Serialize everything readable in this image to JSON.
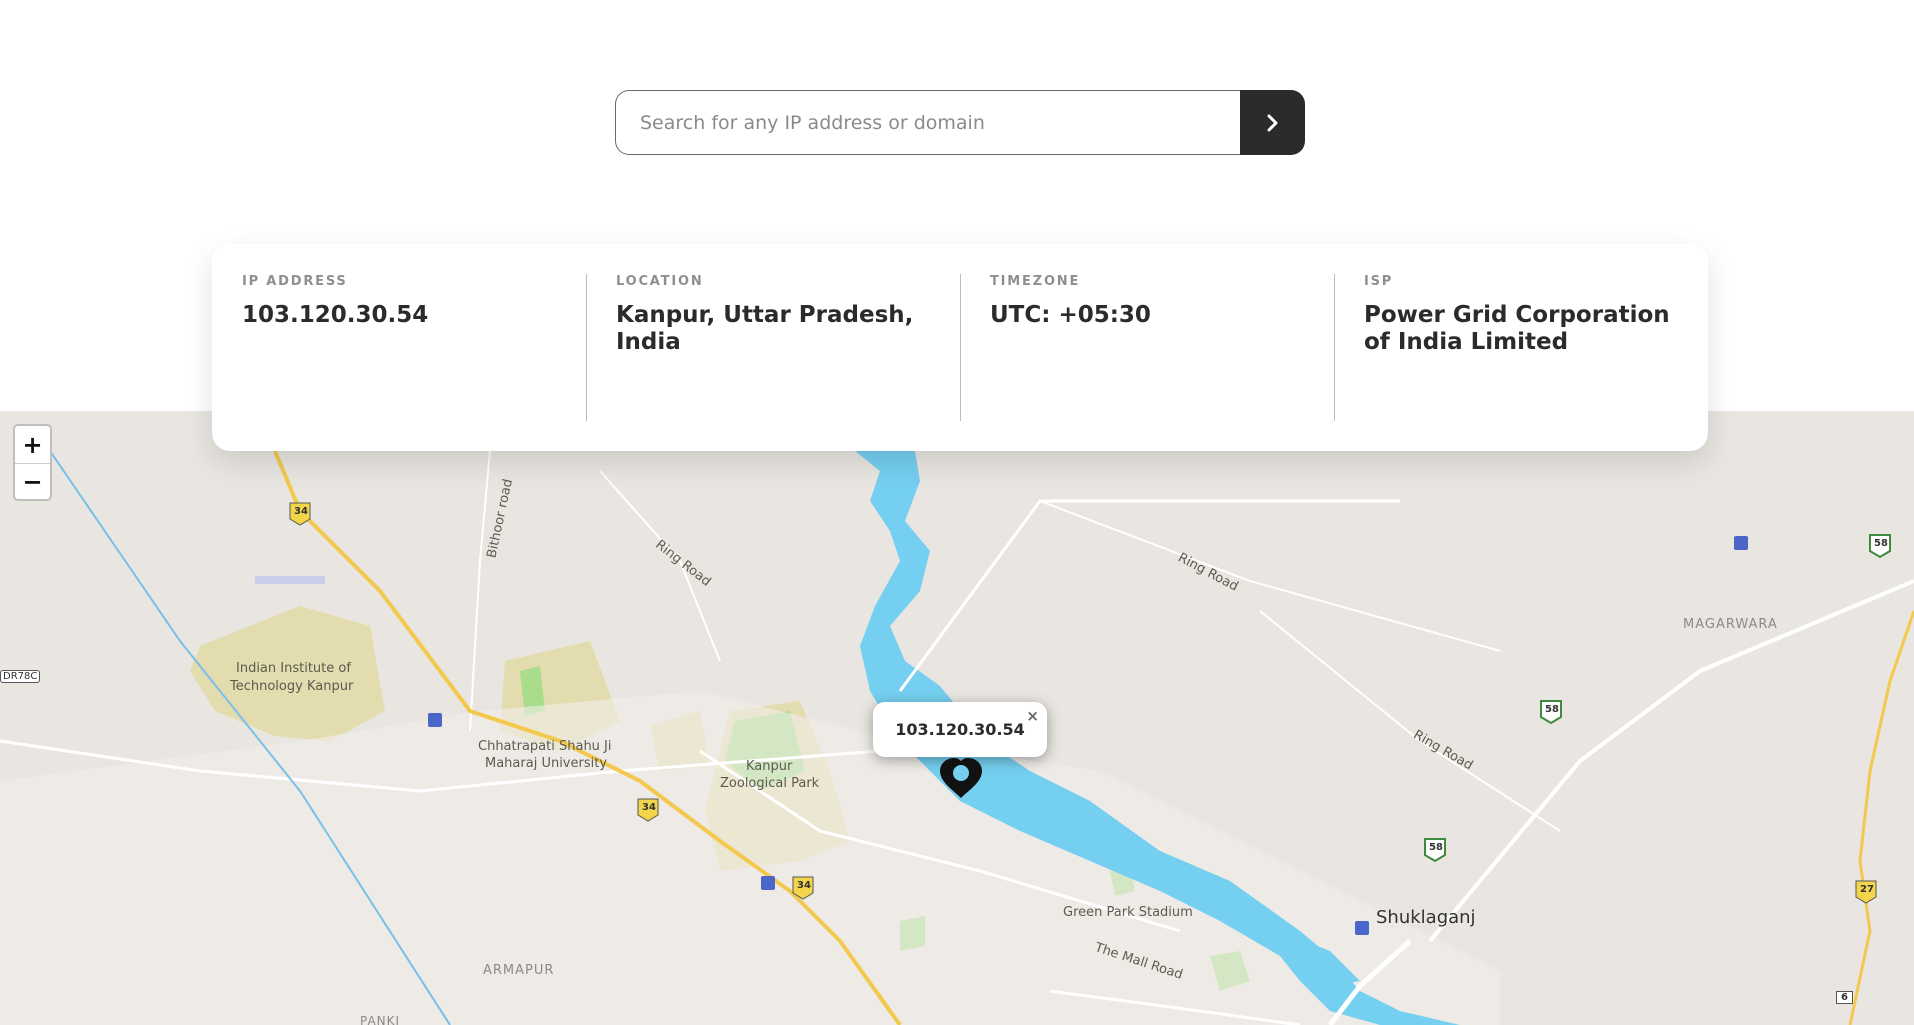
{
  "search": {
    "placeholder": "Search for any IP address or domain",
    "value": ""
  },
  "info": [
    {
      "label": "IP ADDRESS",
      "value": "103.120.30.54"
    },
    {
      "label": "LOCATION",
      "value": "Kanpur, Uttar Pradesh, India"
    },
    {
      "label": "TIMEZONE",
      "value": "UTC: +05:30"
    },
    {
      "label": "ISP",
      "value": "Power Grid Corporation of India Limited"
    }
  ],
  "map": {
    "zoom_in": "+",
    "zoom_out": "−",
    "popup_text": "103.120.30.54",
    "popup_close": "×",
    "labels": {
      "iit": "Indian Institute of",
      "iit2": "Technology Kanpur",
      "csjm": "Chhatrapati Shahu Ji",
      "csjm2": "Maharaj University",
      "zoo": "Kanpur",
      "zoo2": "Zoological Park",
      "greenpark": "Green Park Stadium",
      "mallroad": "The Mall Road",
      "armapur": "ARMAPUR",
      "shuklaganj": "Shuklaganj",
      "magarwara": "MAGARWARA",
      "ringroad": "Ring Road",
      "bithoor": "Bithoor road",
      "panki": "PANKI",
      "road_sign": "DR78C",
      "hw34": "34",
      "hw58": "58",
      "hw27": "27",
      "hw6": "6"
    },
    "colors": {
      "land": "#e9e6e1",
      "water": "#75cff0",
      "highway": "#f2c94c",
      "park": "#e3dcae",
      "green": "#a9dc8b"
    }
  }
}
